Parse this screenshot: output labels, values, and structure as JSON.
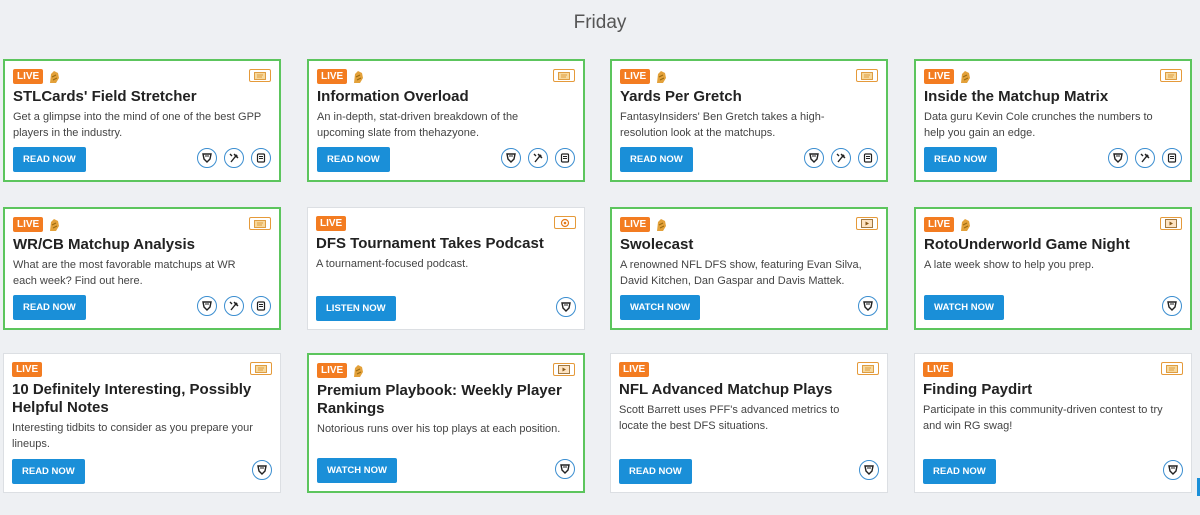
{
  "day": "Friday",
  "colors": {
    "live": "#f37c21",
    "button": "#1a8fd8",
    "highlight": "#5cc55d",
    "icon": "#3b8ed0"
  },
  "cards": [
    {
      "live": "LIVE",
      "premium": true,
      "type": "article",
      "title": "STLCards' Field Stretcher",
      "desc1": "Get a glimpse into the mind of one of the best GPP",
      "desc2": "players in the industry.",
      "button": "READ NOW",
      "highlight": true,
      "icons": [
        "shield-icon",
        "tool-icon",
        "list-icon"
      ]
    },
    {
      "live": "LIVE",
      "premium": true,
      "type": "article",
      "title": "Information Overload",
      "desc1": "An in-depth, stat-driven breakdown of the",
      "desc2": "upcoming slate from thehazyone.",
      "button": "READ NOW",
      "highlight": true,
      "icons": [
        "shield-icon",
        "tool-icon",
        "list-icon"
      ]
    },
    {
      "live": "LIVE",
      "premium": true,
      "type": "article",
      "title": "Yards Per Gretch",
      "desc1": "FantasyInsiders' Ben Gretch takes a high-",
      "desc2": "resolution look at the matchups.",
      "button": "READ NOW",
      "highlight": true,
      "icons": [
        "shield-icon",
        "tool-icon",
        "list-icon"
      ]
    },
    {
      "live": "LIVE",
      "premium": true,
      "type": "article",
      "title": "Inside the Matchup Matrix",
      "desc1": "Data guru Kevin Cole crunches the numbers to",
      "desc2": "help you gain an edge.",
      "button": "READ NOW",
      "highlight": true,
      "icons": [
        "shield-icon",
        "tool-icon",
        "list-icon"
      ]
    },
    {
      "live": "LIVE",
      "premium": true,
      "type": "article",
      "title": "WR/CB Matchup Analysis",
      "desc1": "What are the most favorable matchups at WR",
      "desc2": "each week? Find out here.",
      "button": "READ NOW",
      "highlight": true,
      "icons": [
        "shield-icon",
        "tool-icon",
        "list-icon"
      ]
    },
    {
      "live": "LIVE",
      "premium": false,
      "type": "podcast",
      "title": "DFS Tournament Takes Podcast",
      "desc1": "A tournament-focused podcast.",
      "desc2": "",
      "button": "LISTEN NOW",
      "highlight": false,
      "icons": [
        "shield-icon"
      ]
    },
    {
      "live": "LIVE",
      "premium": true,
      "type": "video",
      "title": "Swolecast",
      "desc1": "A renowned NFL DFS show, featuring Evan Silva,",
      "desc2": "David Kitchen, Dan Gaspar and Davis Mattek.",
      "button": "WATCH NOW",
      "highlight": true,
      "icons": [
        "shield-icon"
      ]
    },
    {
      "live": "LIVE",
      "premium": true,
      "type": "video",
      "title": "RotoUnderworld Game Night",
      "desc1": "A late week show to help you prep.",
      "desc2": "",
      "button": "WATCH NOW",
      "highlight": true,
      "icons": [
        "shield-icon"
      ]
    },
    {
      "live": "LIVE",
      "premium": false,
      "type": "article",
      "title": "10 Definitely Interesting, Possibly Helpful Notes",
      "desc1": "Interesting tidbits to consider as you prepare your",
      "desc2": "lineups.",
      "button": "READ NOW",
      "highlight": false,
      "icons": [
        "shield-icon"
      ]
    },
    {
      "live": "LIVE",
      "premium": true,
      "type": "video",
      "title": "Premium Playbook: Weekly Player Rankings",
      "desc1": "Notorious runs over his top plays at each position.",
      "desc2": "",
      "button": "WATCH NOW",
      "highlight": true,
      "icons": [
        "shield-icon"
      ]
    },
    {
      "live": "LIVE",
      "premium": false,
      "type": "article",
      "title": "NFL Advanced Matchup Plays",
      "desc1": "Scott Barrett uses PFF's advanced metrics to",
      "desc2": "locate the best DFS situations.",
      "button": "READ NOW",
      "highlight": false,
      "icons": [
        "shield-icon"
      ]
    },
    {
      "live": "LIVE",
      "premium": false,
      "type": "article",
      "title": "Finding Paydirt",
      "desc1": "Participate in this community-driven contest to try",
      "desc2": "and win RG swag!",
      "button": "READ NOW",
      "highlight": false,
      "icons": [
        "shield-icon"
      ]
    }
  ]
}
